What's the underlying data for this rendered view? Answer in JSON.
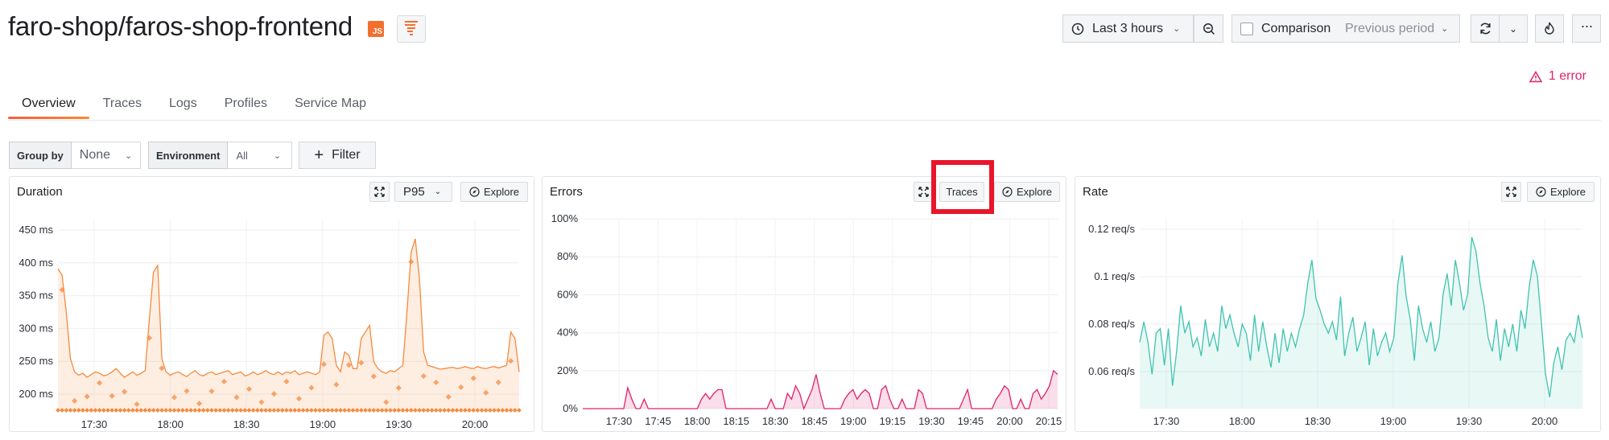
{
  "header": {
    "title": "faro-shop/faros-shop-frontend",
    "js_badge": "JS",
    "time_range": "Last 3 hours",
    "comparison_label": "Comparison",
    "comparison_period": "Previous period",
    "error_count": "1 error"
  },
  "tabs": [
    {
      "label": "Overview"
    },
    {
      "label": "Traces"
    },
    {
      "label": "Logs"
    },
    {
      "label": "Profiles"
    },
    {
      "label": "Service Map"
    }
  ],
  "filters": {
    "group_by_label": "Group by",
    "group_by_value": "None",
    "environment_label": "Environment",
    "environment_value": "All",
    "filter_button": "Filter"
  },
  "panels": {
    "duration": {
      "title": "Duration",
      "percentile": "P95",
      "explore": "Explore"
    },
    "errors": {
      "title": "Errors",
      "traces": "Traces",
      "explore": "Explore"
    },
    "rate": {
      "title": "Rate",
      "explore": "Explore"
    }
  },
  "colors": {
    "duration": "#f58a3d",
    "errors": "#e0226e",
    "rate": "#3fc3b0",
    "highlight": "#e8162b",
    "error_text": "#e0226e"
  },
  "chart_data": [
    {
      "type": "area",
      "title": "Duration",
      "yunit": "ms",
      "y_ticks": [
        "450 ms",
        "400 ms",
        "350 ms",
        "300 ms",
        "250 ms",
        "200 ms"
      ],
      "x_ticks": [
        "17:30",
        "18:00",
        "18:30",
        "19:00",
        "19:30",
        "20:00"
      ],
      "ylim": [
        180,
        470
      ],
      "values": [
        395,
        385,
        330,
        260,
        240,
        235,
        238,
        232,
        236,
        240,
        238,
        234,
        236,
        240,
        245,
        238,
        232,
        236,
        240,
        235,
        238,
        242,
        320,
        390,
        400,
        260,
        240,
        235,
        238,
        240,
        236,
        233,
        238,
        242,
        236,
        234,
        238,
        240,
        236,
        238,
        240,
        242,
        236,
        238,
        240,
        234,
        236,
        240,
        236,
        238,
        242,
        238,
        236,
        240,
        236,
        240,
        238,
        242,
        236,
        238,
        240,
        238,
        236,
        240,
        295,
        300,
        290,
        250,
        240,
        270,
        265,
        245,
        245,
        290,
        300,
        310,
        255,
        245,
        240,
        238,
        242,
        240,
        245,
        250,
        330,
        420,
        440,
        380,
        270,
        250,
        248,
        246,
        244,
        245,
        246,
        247,
        245,
        246,
        248,
        246,
        245,
        248,
        246,
        245,
        247,
        248,
        246,
        248,
        250,
        300,
        290,
        240
      ]
    },
    {
      "type": "area",
      "title": "Errors",
      "y_ticks": [
        "100%",
        "80%",
        "60%",
        "40%",
        "20%",
        "0%"
      ],
      "x_ticks": [
        "17:30",
        "17:45",
        "18:00",
        "18:15",
        "18:30",
        "18:45",
        "19:00",
        "19:15",
        "19:30",
        "19:45",
        "20:00",
        "20:15"
      ],
      "ylim": [
        0,
        100
      ],
      "values": [
        0,
        0,
        0,
        0,
        0,
        0,
        0,
        0,
        0,
        0,
        0,
        11,
        5,
        0,
        0,
        5,
        0,
        0,
        0,
        0,
        0,
        0,
        0,
        0,
        0,
        0,
        0,
        0,
        0,
        5,
        8,
        5,
        8,
        10,
        10,
        0,
        0,
        0,
        0,
        0,
        0,
        0,
        0,
        0,
        0,
        0,
        5,
        0,
        0,
        0,
        8,
        5,
        12,
        8,
        0,
        5,
        10,
        18,
        8,
        0,
        0,
        0,
        0,
        0,
        5,
        8,
        10,
        5,
        8,
        10,
        8,
        0,
        0,
        10,
        12,
        5,
        0,
        0,
        5,
        0,
        0,
        0,
        10,
        8,
        0,
        0,
        0,
        0,
        0,
        0,
        0,
        0,
        0,
        5,
        10,
        0,
        0,
        0,
        0,
        0,
        0,
        5,
        8,
        12,
        10,
        0,
        0,
        5,
        0,
        0,
        8,
        10,
        5,
        8,
        12,
        20,
        18
      ]
    },
    {
      "type": "line",
      "title": "Rate",
      "y_ticks": [
        "0.12 req/s",
        "0.1 req/s",
        "0.08 req/s",
        "0.06 req/s"
      ],
      "x_ticks": [
        "17:30",
        "18:00",
        "18:30",
        "19:00",
        "19:30",
        "20:00"
      ],
      "ylim": [
        0.045,
        0.128
      ],
      "values": [
        0.074,
        0.083,
        0.074,
        0.06,
        0.078,
        0.08,
        0.064,
        0.08,
        0.055,
        0.07,
        0.09,
        0.078,
        0.083,
        0.072,
        0.076,
        0.068,
        0.084,
        0.072,
        0.078,
        0.07,
        0.09,
        0.08,
        0.086,
        0.078,
        0.072,
        0.082,
        0.078,
        0.066,
        0.086,
        0.07,
        0.083,
        0.072,
        0.063,
        0.078,
        0.065,
        0.08,
        0.07,
        0.078,
        0.072,
        0.08,
        0.086,
        0.1,
        0.11,
        0.093,
        0.088,
        0.082,
        0.078,
        0.083,
        0.075,
        0.094,
        0.068,
        0.078,
        0.085,
        0.07,
        0.076,
        0.083,
        0.064,
        0.08,
        0.068,
        0.074,
        0.078,
        0.07,
        0.076,
        0.1,
        0.112,
        0.094,
        0.084,
        0.066,
        0.09,
        0.08,
        0.074,
        0.083,
        0.07,
        0.076,
        0.095,
        0.104,
        0.09,
        0.11,
        0.1,
        0.088,
        0.095,
        0.12,
        0.114,
        0.1,
        0.09,
        0.076,
        0.07,
        0.084,
        0.066,
        0.08,
        0.072,
        0.082,
        0.07,
        0.088,
        0.08,
        0.098,
        0.11,
        0.103,
        0.082,
        0.06,
        0.05,
        0.065,
        0.072,
        0.062,
        0.075,
        0.078,
        0.074,
        0.086,
        0.076
      ]
    }
  ]
}
